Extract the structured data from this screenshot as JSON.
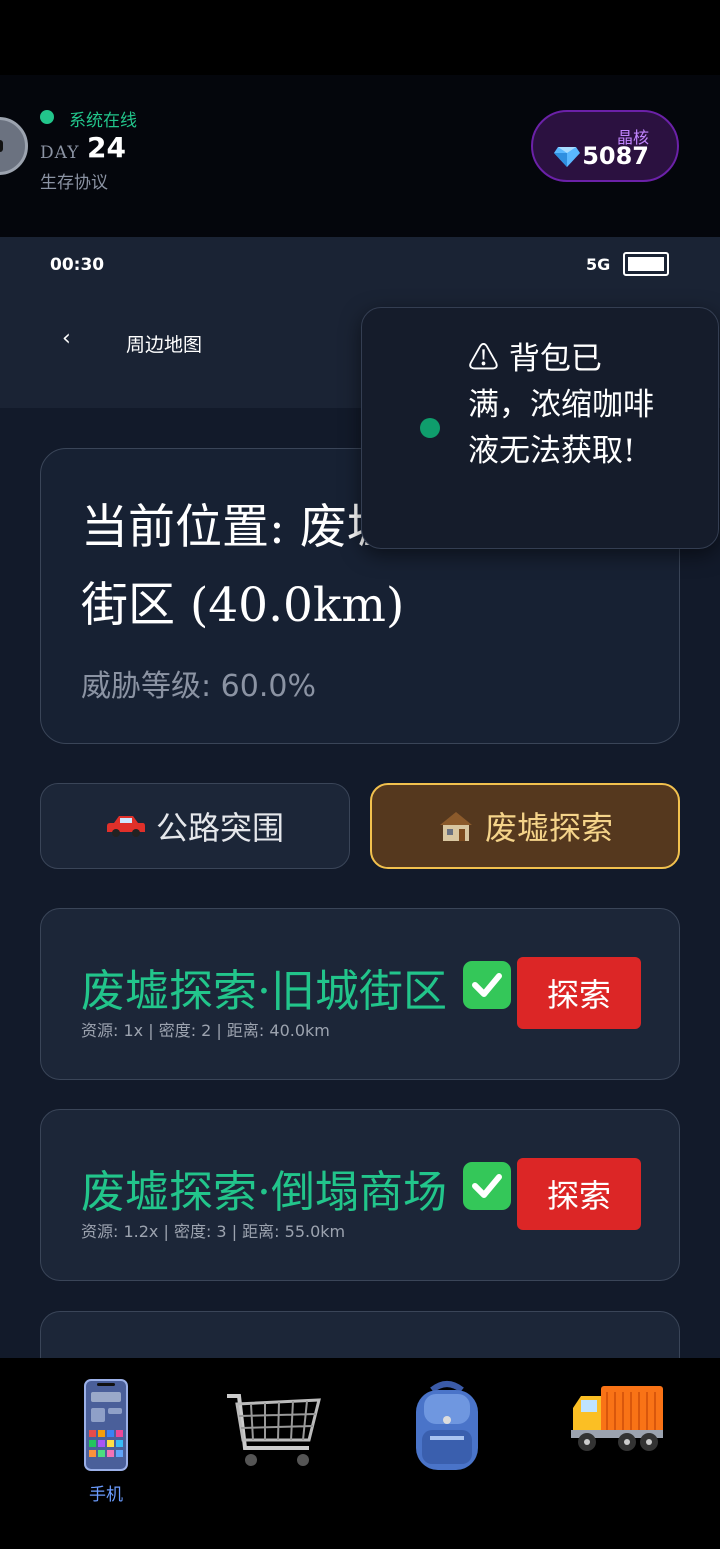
{
  "header": {
    "status_text": "系统在线",
    "day_label": "DAY",
    "day_number": "24",
    "protocol": "生存协议",
    "crystal_label": "晶核",
    "crystal_value": "5087"
  },
  "phone_status": {
    "time": "00:30",
    "signal": "5G"
  },
  "nav": {
    "back_label": "‹",
    "title": "周边地图"
  },
  "location": {
    "title": "当前位置: 废墟探索·旧城街区 (40.0km)",
    "threat": "威胁等级: 60.0%"
  },
  "modes": [
    {
      "label": "公路突围",
      "icon": "car-icon",
      "active": false
    },
    {
      "label": "废墟探索",
      "icon": "house-icon",
      "active": true
    }
  ],
  "places": [
    {
      "name": "废墟探索·旧城街区",
      "meta": "资源: 1x | 密度: 2 | 距离: 40.0km",
      "button": "探索"
    },
    {
      "name": "废墟探索·倒塌商场",
      "meta": "资源: 1.2x | 密度: 3 | 距离: 55.0km",
      "button": "探索"
    }
  ],
  "toast": {
    "text": "⚠ 背包已满，浓缩咖啡液无法获取!"
  },
  "tabs": [
    {
      "label": "手机",
      "icon": "phone-icon",
      "active": true
    },
    {
      "label": "",
      "icon": "cart-icon",
      "active": false
    },
    {
      "label": "",
      "icon": "backpack-icon",
      "active": false
    },
    {
      "label": "",
      "icon": "truck-icon",
      "active": false
    }
  ],
  "colors": {
    "accent_green": "#22c58b",
    "explore_red": "#dc2626",
    "active_mode_border": "#f2c14e",
    "crystal_purple": "#c084fc"
  }
}
